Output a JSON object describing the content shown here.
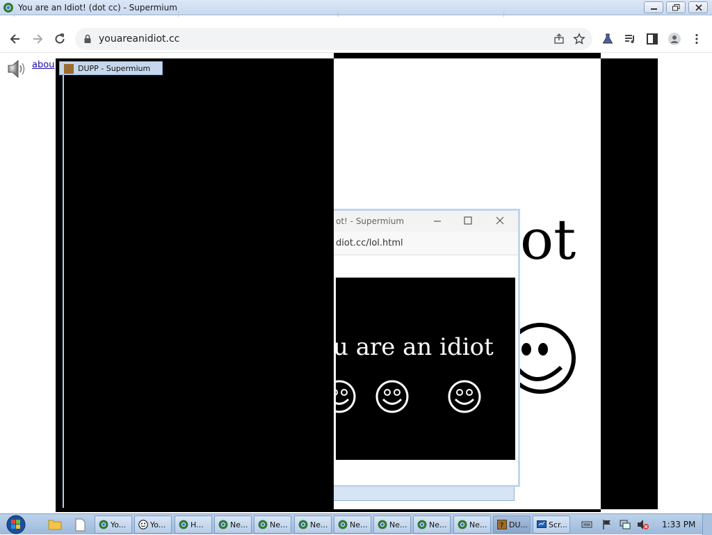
{
  "window": {
    "title": "You are an Idiot! (dot cc) - Supermium"
  },
  "toolbar": {
    "url": "youareanidiot.cc"
  },
  "page": {
    "about_link": "abou",
    "big_text": "ot",
    "smiley": "smiley-face-icon"
  },
  "popup": {
    "title": "ot! - Supermium",
    "url": "diot.cc/lol.html",
    "text": "u are an idiot"
  },
  "dupp": {
    "title": "DUPP - Supermium"
  },
  "taskbar": {
    "items": [
      {
        "label": "Yo...",
        "icon": "supermium-icon"
      },
      {
        "label": "Yo...",
        "icon": "smiley-icon"
      },
      {
        "label": "H...",
        "icon": "supermium-icon"
      },
      {
        "label": "Ne...",
        "icon": "supermium-icon"
      },
      {
        "label": "Ne...",
        "icon": "supermium-icon"
      },
      {
        "label": "Ne...",
        "icon": "supermium-icon"
      },
      {
        "label": "Ne...",
        "icon": "supermium-icon"
      },
      {
        "label": "Ne...",
        "icon": "supermium-icon"
      },
      {
        "label": "Ne...",
        "icon": "supermium-icon"
      },
      {
        "label": "Ne...",
        "icon": "supermium-icon"
      },
      {
        "label": "DU...",
        "icon": "dupp-icon"
      },
      {
        "label": "Scr...",
        "icon": "screen-recorder-icon"
      }
    ],
    "clock": "1:33 PM"
  },
  "colors": {
    "background": "#ffffff",
    "prank": "#000000",
    "link": "#1a0dab"
  }
}
